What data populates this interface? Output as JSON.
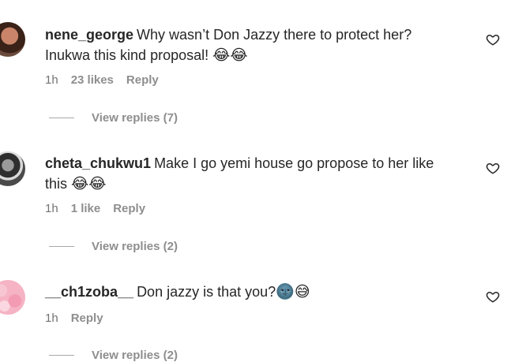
{
  "comments": [
    {
      "username": "nene_george",
      "text_line1": "Why wasn’t Don Jazzy there to protect her?",
      "text_line2": "Inukwa this kind proposal! ",
      "emoji": "😂😂",
      "time": "1h",
      "likes": "23 likes",
      "reply": "Reply",
      "view_replies": "View replies (7)"
    },
    {
      "username": "cheta_chukwu1",
      "text_line1": "Make I go yemi house go propose to her like",
      "text_line2": "this ",
      "emoji": "😂😂",
      "time": "1h",
      "likes": "1 like",
      "reply": "Reply",
      "view_replies": "View replies (2)"
    },
    {
      "username": "__ch1zoba__",
      "text_line1": "Don jazzy is that you?",
      "emoji": "🌚😅",
      "time": "1h",
      "reply": "Reply",
      "view_replies": "View replies (2)"
    }
  ]
}
